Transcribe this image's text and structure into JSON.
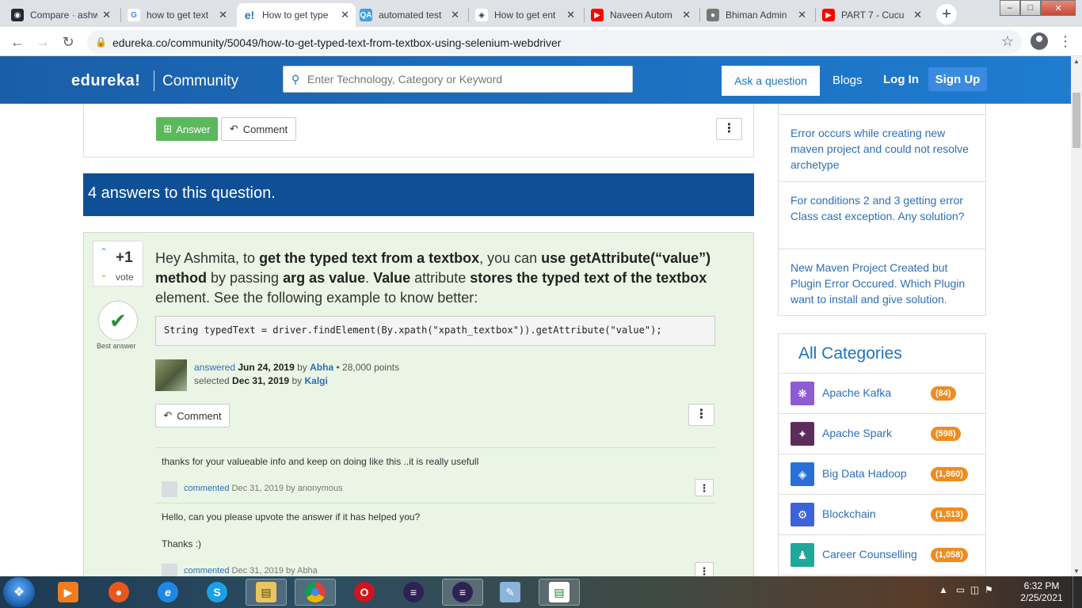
{
  "browser": {
    "tabs": [
      {
        "title": "Compare · ashw",
        "icon": "github-icon"
      },
      {
        "title": "how to get text",
        "icon": "google-icon"
      },
      {
        "title": "How to get type",
        "icon": "edureka-icon"
      },
      {
        "title": "automated test",
        "icon": "qa-icon"
      },
      {
        "title": "How to get ent",
        "icon": "diamond-site-icon"
      },
      {
        "title": "Naveen Autom",
        "icon": "youtube-icon"
      },
      {
        "title": "Bhiman Admin",
        "icon": "globe-icon"
      },
      {
        "title": "PART 7 - Cucu",
        "icon": "youtube-icon"
      }
    ],
    "url": "edureka.co/community/50049/how-to-get-typed-text-from-textbox-using-selenium-webdriver"
  },
  "site": {
    "logo": "edureka!",
    "logo_section": "Community",
    "search_placeholder": "Enter Technology, Category or Keyword",
    "ask_label": "Ask a question",
    "blogs_label": "Blogs",
    "login_label": "Log In",
    "signup_label": "Sign Up"
  },
  "question": {
    "answer_label": "Answer",
    "comment_label": "Comment"
  },
  "answers_header": "4 answers to this question.",
  "answer": {
    "vote_count": "+1",
    "vote_label": "vote",
    "best_label": "Best answer",
    "text_parts": [
      {
        "t": "Hey Ashmita, to ",
        "b": false
      },
      {
        "t": "get the typed text from a textbox",
        "b": true
      },
      {
        "t": ", you can ",
        "b": false
      },
      {
        "t": "use getAttribute(“value”) method",
        "b": true
      },
      {
        "t": " by passing ",
        "b": false
      },
      {
        "t": "arg as value",
        "b": true
      },
      {
        "t": ". ",
        "b": false
      },
      {
        "t": "Value",
        "b": true
      },
      {
        "t": " attribute ",
        "b": false
      },
      {
        "t": "stores the typed text of the textbox",
        "b": true
      },
      {
        "t": " element. See the following example to know better:",
        "b": false
      }
    ],
    "code": "String typedText = driver.findElement(By.xpath(\"xpath_textbox\")).getAttribute(\"value\");",
    "answered_word": "answered",
    "answered_date": "Jun 24, 2019",
    "by_word": "by",
    "author": "Abha",
    "points": "28,000 points",
    "selected_word": "selected",
    "selected_date": "Dec 31, 2019",
    "selected_by": "Kalgi",
    "comment_label": "Comment"
  },
  "comments": [
    {
      "text": "thanks for your valueable info and keep on doing like this ..it is really usefull",
      "meta_word": "commented",
      "meta_rest": "Dec 31, 2019 by anonymous"
    },
    {
      "text": "Hello, can you please upvote the answer if it has helped you?",
      "text2": "Thanks :)",
      "meta_word": "commented",
      "meta_rest": "Dec 31, 2019 by Abha"
    }
  ],
  "related": [
    "Error occurs while creating new maven project and could not resolve archetype",
    "For conditions 2 and 3 getting error Class cast exception. Any solution?",
    "New Maven Project Created but Plugin Error Occured. Which Plugin want to install and give solution."
  ],
  "categories_title": "All Categories",
  "categories": [
    {
      "name": "Apache Kafka",
      "count": "(84)",
      "color": "#8e5bd3"
    },
    {
      "name": "Apache Spark",
      "count": "(598)",
      "color": "#5b2d5c"
    },
    {
      "name": "Big Data Hadoop",
      "count": "(1,860)",
      "color": "#2a6fd6"
    },
    {
      "name": "Blockchain",
      "count": "(1,513)",
      "color": "#3c63d8"
    },
    {
      "name": "Career Counselling",
      "count": "(1,058)",
      "color": "#1fa89a"
    }
  ],
  "taskbar": {
    "time": "6:32 PM",
    "date": "2/25/2021"
  },
  "colors": {
    "brand": "#1e73be",
    "answer_bg": "#eaf5e5",
    "answer_btn": "#5cb85c",
    "count_badge": "#f08c1e"
  }
}
